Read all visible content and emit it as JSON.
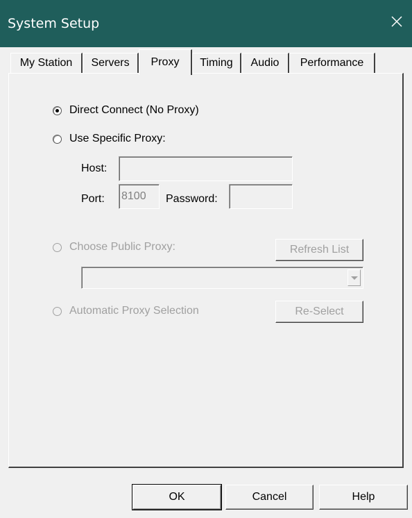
{
  "window": {
    "title": "System Setup",
    "close_glyph": "close-icon"
  },
  "tabs": [
    {
      "label": "My Station",
      "active": false
    },
    {
      "label": "Servers",
      "active": false
    },
    {
      "label": "Proxy",
      "active": true
    },
    {
      "label": "Timing",
      "active": false
    },
    {
      "label": "Audio",
      "active": false
    },
    {
      "label": "Performance",
      "active": false
    }
  ],
  "proxy": {
    "direct_connect_label": "Direct Connect (No Proxy)",
    "direct_connect_selected": true,
    "specific_proxy_label": "Use Specific Proxy:",
    "host_label": "Host:",
    "host_value": "",
    "port_label": "Port:",
    "port_value": "8100",
    "password_label": "Password:",
    "password_value": "",
    "public_proxy_label": "Choose Public Proxy:",
    "refresh_button": "Refresh List",
    "public_proxy_selected": "",
    "auto_proxy_label": "Automatic Proxy Selection",
    "reselect_button": "Re-Select"
  },
  "footer": {
    "ok": "OK",
    "cancel": "Cancel",
    "help": "Help"
  },
  "colors": {
    "titlebar": "#1f5e5b",
    "disabled_text": "#a0a0a0",
    "dialog_bg": "#f0f0f0"
  }
}
